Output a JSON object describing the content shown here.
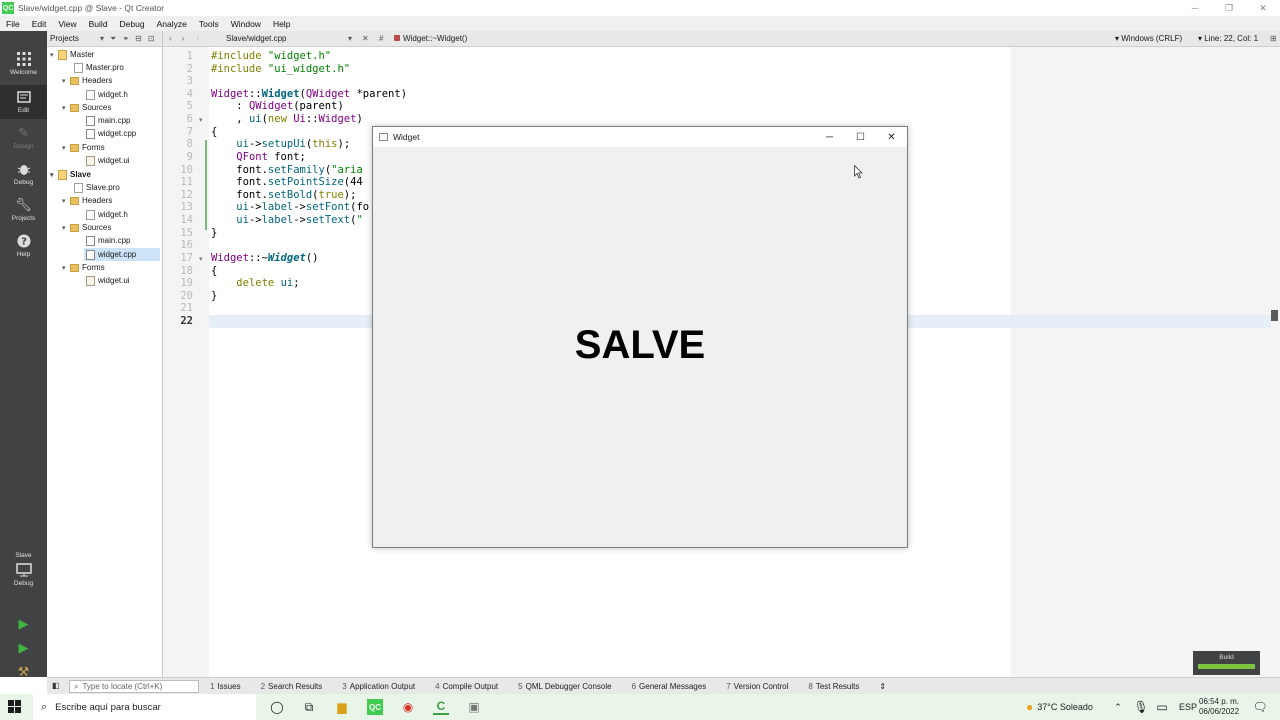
{
  "window": {
    "title": "Slave/widget.cpp @ Slave - Qt Creator"
  },
  "menu": [
    "File",
    "Edit",
    "View",
    "Build",
    "Debug",
    "Analyze",
    "Tools",
    "Window",
    "Help"
  ],
  "modes": [
    {
      "label": "Welcome",
      "icon": "grid-icon"
    },
    {
      "label": "Edit",
      "icon": "edit-icon"
    },
    {
      "label": "Design",
      "icon": "design-icon"
    },
    {
      "label": "Debug",
      "icon": "bug-icon"
    },
    {
      "label": "Projects",
      "icon": "wrench-icon"
    },
    {
      "label": "Help",
      "icon": "help-icon"
    }
  ],
  "kit": {
    "project": "Slave",
    "config": "Debug"
  },
  "projects_panel": {
    "header": "Projects",
    "tree": [
      {
        "label": "Master",
        "type": "proj"
      },
      {
        "label": "Master.pro",
        "type": "file"
      },
      {
        "label": "Headers",
        "type": "folder"
      },
      {
        "label": "widget.h",
        "type": "h"
      },
      {
        "label": "Sources",
        "type": "folder"
      },
      {
        "label": "main.cpp",
        "type": "cpp"
      },
      {
        "label": "widget.cpp",
        "type": "cpp"
      },
      {
        "label": "Forms",
        "type": "folder"
      },
      {
        "label": "widget.ui",
        "type": "form"
      },
      {
        "label": "Slave",
        "type": "proj"
      },
      {
        "label": "Slave.pro",
        "type": "file"
      },
      {
        "label": "Headers",
        "type": "folder"
      },
      {
        "label": "widget.h",
        "type": "h"
      },
      {
        "label": "Sources",
        "type": "folder"
      },
      {
        "label": "main.cpp",
        "type": "cpp"
      },
      {
        "label": "widget.cpp",
        "type": "cpp"
      },
      {
        "label": "Forms",
        "type": "folder"
      },
      {
        "label": "widget.ui",
        "type": "form"
      }
    ]
  },
  "editor": {
    "file": "Slave/widget.cpp",
    "symbol": "Widget::~Widget()",
    "encoding": "Windows (CRLF)",
    "position": "Line: 22, Col: 1",
    "line_numbers": [
      "1",
      "2",
      "3",
      "4",
      "5",
      "6",
      "7",
      "8",
      "9",
      "10",
      "11",
      "12",
      "13",
      "14",
      "15",
      "16",
      "17",
      "18",
      "19",
      "20",
      "21",
      "22"
    ]
  },
  "widget_window": {
    "title": "Widget",
    "label_text": "SALVE"
  },
  "output": {
    "locator_placeholder": "Type to locate (Ctrl+K)",
    "tabs": [
      {
        "n": "1",
        "label": "Issues"
      },
      {
        "n": "2",
        "label": "Search Results"
      },
      {
        "n": "3",
        "label": "Application Output"
      },
      {
        "n": "4",
        "label": "Compile Output"
      },
      {
        "n": "5",
        "label": "QML Debugger Console"
      },
      {
        "n": "6",
        "label": "General Messages"
      },
      {
        "n": "7",
        "label": "Version Control"
      },
      {
        "n": "8",
        "label": "Test Results"
      }
    ],
    "build_label": "Build"
  },
  "taskbar": {
    "search_placeholder": "Escribe aquí para buscar",
    "weather": "37°C  Soleado",
    "lang": "ESP",
    "time": "06:54 p. m.",
    "date": "06/06/2022"
  }
}
